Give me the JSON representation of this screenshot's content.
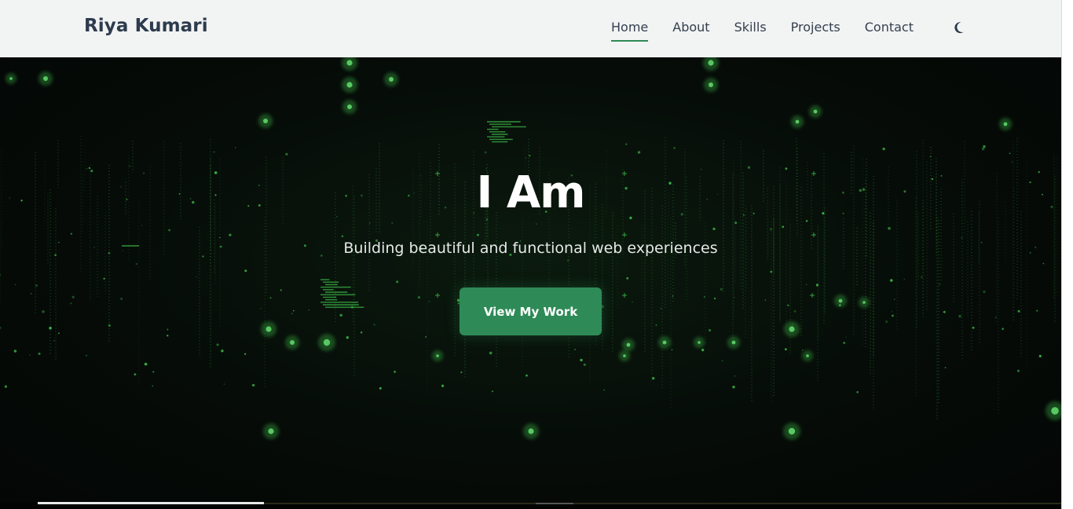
{
  "brand": {
    "name": "Riya Kumari"
  },
  "nav": {
    "items": [
      {
        "label": "Home",
        "active": true
      },
      {
        "label": "About",
        "active": false
      },
      {
        "label": "Skills",
        "active": false
      },
      {
        "label": "Projects",
        "active": false
      },
      {
        "label": "Contact",
        "active": false
      }
    ],
    "theme_toggle_icon": "moon-icon"
  },
  "hero": {
    "title": "I Am",
    "subtitle": "Building beautiful and functional web experiences",
    "cta_label": "View My Work"
  },
  "colors": {
    "accent": "#2e8b57",
    "brand_text": "#2c3b4d",
    "nav_bg": "#f2f3f3",
    "hero_bg": "#050807",
    "matrix_green": "#3fbf4a"
  }
}
